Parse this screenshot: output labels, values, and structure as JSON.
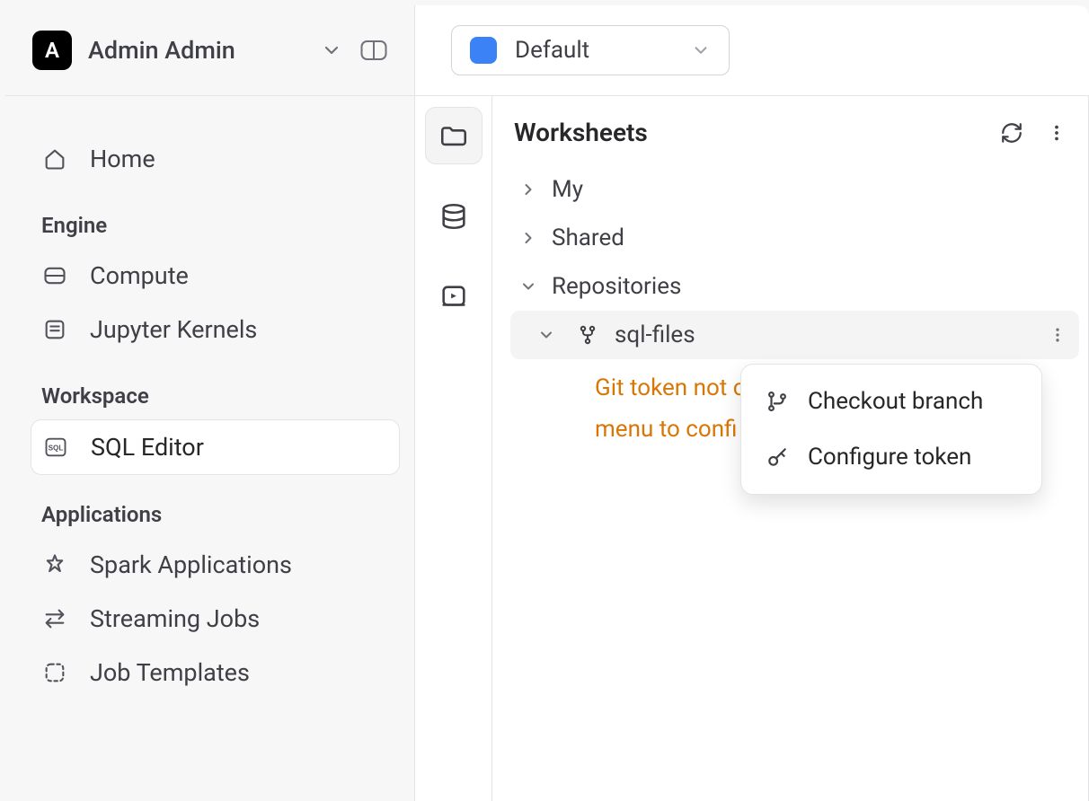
{
  "user": {
    "initial": "A",
    "name": "Admin Admin"
  },
  "sidebar": {
    "home": "Home",
    "sections": {
      "engine": "Engine",
      "workspace": "Workspace",
      "applications": "Applications"
    },
    "items": {
      "compute": "Compute",
      "jupyter": "Jupyter Kernels",
      "sql_editor": "SQL Editor",
      "spark_apps": "Spark Applications",
      "streaming": "Streaming Jobs",
      "templates": "Job Templates"
    }
  },
  "warehouse": {
    "selected": "Default"
  },
  "panel": {
    "title": "Worksheets",
    "tree": {
      "my": "My",
      "shared": "Shared",
      "repositories": "Repositories",
      "repo_name": "sql-files",
      "warn_line1": "Git token not c",
      "warn_line2": "menu to confi"
    }
  },
  "menu": {
    "checkout": "Checkout branch",
    "configure": "Configure token"
  }
}
